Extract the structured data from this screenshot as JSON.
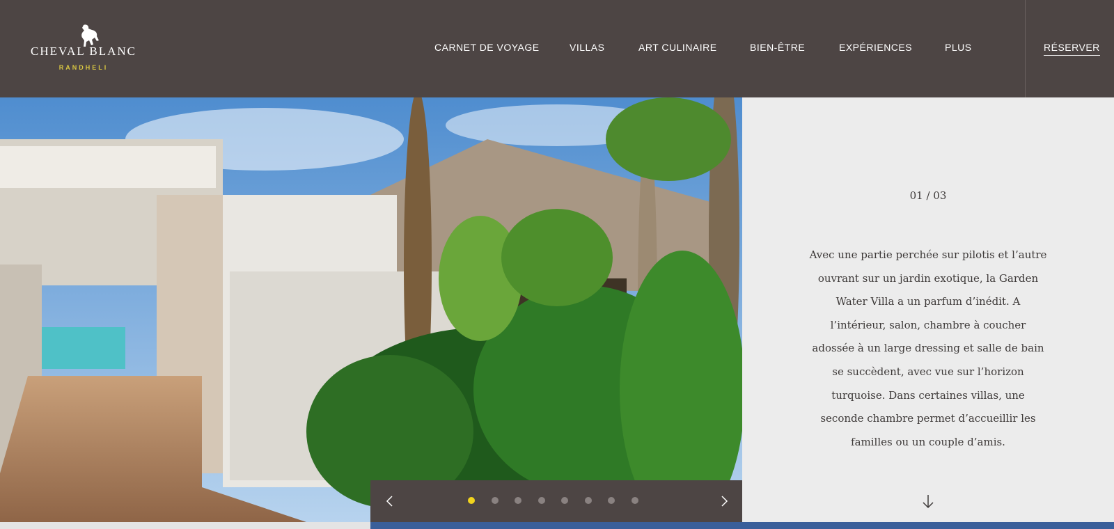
{
  "brand": {
    "name": "CHEVAL BLANC",
    "location": "RANDHELI",
    "accent_color": "#d8c642"
  },
  "nav": {
    "items": [
      {
        "label": "CARNET DE VOYAGE"
      },
      {
        "label": "VILLAS"
      },
      {
        "label": "ART CULINAIRE"
      },
      {
        "label": "BIEN-ÊTRE"
      },
      {
        "label": "EXPÉRIENCES"
      },
      {
        "label": "PLUS"
      }
    ],
    "reserve_label": "RÉSERVER"
  },
  "slider": {
    "counter": "01 / 03",
    "description": "Avec une partie perchée sur pilotis et l’autre ouvrant sur un jardin exotique, la Garden Water Villa a un parfum d’inédit. A l’intérieur, salon, chambre à coucher adossée à un large dressing et salle de bain se succèdent, avec vue sur l’horizon turquoise. Dans certaines villas, une seconde chambre permet d’accueillir les familles ou un couple d’amis.",
    "dot_count": 8,
    "active_dot": 1,
    "active_dot_color": "#f2d41d",
    "icons": {
      "prev": "chevron-left-icon",
      "next": "chevron-right-icon",
      "scroll": "arrow-down-icon"
    }
  },
  "colors": {
    "header_bg": "#4d4544",
    "panel_bg": "#ececec",
    "text": "#3d3938"
  }
}
